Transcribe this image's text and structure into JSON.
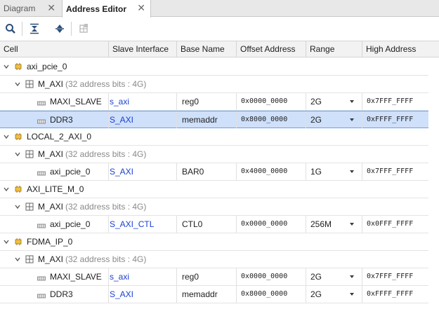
{
  "tabs": [
    {
      "label": "Diagram",
      "active": false
    },
    {
      "label": "Address Editor",
      "active": true
    }
  ],
  "toolbar": {
    "buttons": [
      "search-icon",
      "collapse-all-icon",
      "expand-all-icon",
      "auto-assign-icon"
    ]
  },
  "columns": [
    "Cell",
    "Slave Interface",
    "Base Name",
    "Offset Address",
    "Range",
    "High Address"
  ],
  "rows": [
    {
      "kind": "cell",
      "level": 0,
      "name": "axi_pcie_0"
    },
    {
      "kind": "space",
      "level": 1,
      "name": "M_AXI",
      "note": "(32 address bits : 4G)"
    },
    {
      "kind": "seg",
      "level": 2,
      "name": "MAXI_SLAVE",
      "iface": "s_axi",
      "base": "reg0",
      "offset": "0x0000_0000",
      "range": "2G",
      "high": "0x7FFF_FFFF",
      "selected": false
    },
    {
      "kind": "seg",
      "level": 2,
      "name": "DDR3",
      "iface": "S_AXI",
      "base": "memaddr",
      "offset": "0x8000_0000",
      "range": "2G",
      "high": "0xFFFF_FFFF",
      "selected": true
    },
    {
      "kind": "cell",
      "level": 0,
      "name": "LOCAL_2_AXI_0"
    },
    {
      "kind": "space",
      "level": 1,
      "name": "M_AXI",
      "note": "(32 address bits : 4G)"
    },
    {
      "kind": "seg",
      "level": 2,
      "name": "axi_pcie_0",
      "iface": "S_AXI",
      "base": "BAR0",
      "offset": "0x4000_0000",
      "range": "1G",
      "high": "0x7FFF_FFFF",
      "selected": false
    },
    {
      "kind": "cell",
      "level": 0,
      "name": "AXI_LITE_M_0"
    },
    {
      "kind": "space",
      "level": 1,
      "name": "M_AXI",
      "note": "(32 address bits : 4G)"
    },
    {
      "kind": "seg",
      "level": 2,
      "name": "axi_pcie_0",
      "iface": "S_AXI_CTL",
      "base": "CTL0",
      "offset": "0x0000_0000",
      "range": "256M",
      "high": "0x0FFF_FFFF",
      "selected": false
    },
    {
      "kind": "cell",
      "level": 0,
      "name": "FDMA_IP_0"
    },
    {
      "kind": "space",
      "level": 1,
      "name": "M_AXI",
      "note": "(32 address bits : 4G)"
    },
    {
      "kind": "seg",
      "level": 2,
      "name": "MAXI_SLAVE",
      "iface": "s_axi",
      "base": "reg0",
      "offset": "0x0000_0000",
      "range": "2G",
      "high": "0x7FFF_FFFF",
      "selected": false
    },
    {
      "kind": "seg",
      "level": 2,
      "name": "DDR3",
      "iface": "S_AXI",
      "base": "memaddr",
      "offset": "0x8000_0000",
      "range": "2G",
      "high": "0xFFFF_FFFF",
      "selected": false
    }
  ]
}
